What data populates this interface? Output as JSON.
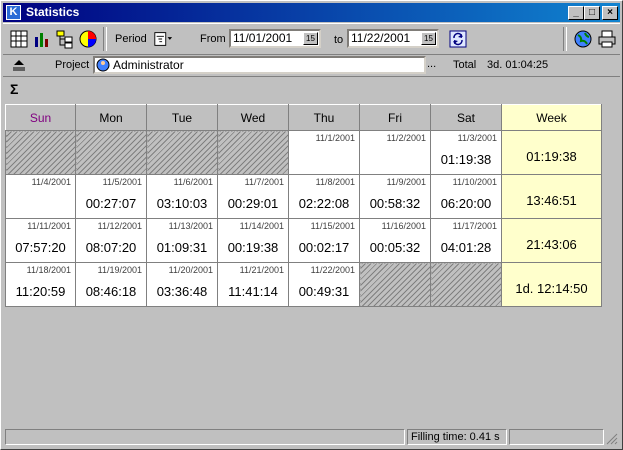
{
  "window": {
    "title": "Statistics",
    "app_icon": "app-logo-icon"
  },
  "toolbar": {
    "period_label": "Period",
    "from_label": "From",
    "from_value": "11/01/2001",
    "to_label": "to",
    "to_value": "11/22/2001",
    "calendar_btn": "15"
  },
  "project": {
    "label": "Project",
    "value": "Administrator",
    "browse": "...",
    "total_label": "Total",
    "total_value": "3d. 01:04:25"
  },
  "sum_symbol": "Σ",
  "days": [
    "Sun",
    "Mon",
    "Tue",
    "Wed",
    "Thu",
    "Fri",
    "Sat",
    "Week"
  ],
  "colors": {
    "sun_header": "#800080",
    "week_header": "#ffffcc",
    "accent": "#000080"
  },
  "weeks": [
    {
      "cells": [
        {
          "date": "",
          "time": "",
          "empty": true
        },
        {
          "date": "",
          "time": "",
          "empty": true
        },
        {
          "date": "",
          "time": "",
          "empty": true
        },
        {
          "date": "",
          "time": "",
          "empty": true
        },
        {
          "date": "11/1/2001",
          "time": ""
        },
        {
          "date": "11/2/2001",
          "time": ""
        },
        {
          "date": "11/3/2001",
          "time": "01:19:38"
        }
      ],
      "total": "01:19:38"
    },
    {
      "cells": [
        {
          "date": "11/4/2001",
          "time": ""
        },
        {
          "date": "11/5/2001",
          "time": "00:27:07"
        },
        {
          "date": "11/6/2001",
          "time": "03:10:03"
        },
        {
          "date": "11/7/2001",
          "time": "00:29:01"
        },
        {
          "date": "11/8/2001",
          "time": "02:22:08"
        },
        {
          "date": "11/9/2001",
          "time": "00:58:32"
        },
        {
          "date": "11/10/2001",
          "time": "06:20:00"
        }
      ],
      "total": "13:46:51"
    },
    {
      "cells": [
        {
          "date": "11/11/2001",
          "time": "07:57:20"
        },
        {
          "date": "11/12/2001",
          "time": "08:07:20"
        },
        {
          "date": "11/13/2001",
          "time": "01:09:31"
        },
        {
          "date": "11/14/2001",
          "time": "00:19:38"
        },
        {
          "date": "11/15/2001",
          "time": "00:02:17"
        },
        {
          "date": "11/16/2001",
          "time": "00:05:32"
        },
        {
          "date": "11/17/2001",
          "time": "04:01:28"
        }
      ],
      "total": "21:43:06"
    },
    {
      "cells": [
        {
          "date": "11/18/2001",
          "time": "11:20:59"
        },
        {
          "date": "11/19/2001",
          "time": "08:46:18"
        },
        {
          "date": "11/20/2001",
          "time": "03:36:48"
        },
        {
          "date": "11/21/2001",
          "time": "11:41:14"
        },
        {
          "date": "11/22/2001",
          "time": "00:49:31"
        },
        {
          "date": "",
          "time": "",
          "empty": true
        },
        {
          "date": "",
          "time": "",
          "empty": true
        }
      ],
      "total": "1d. 12:14:50"
    }
  ],
  "status": {
    "filling_time": "Filling time: 0.41 s"
  }
}
